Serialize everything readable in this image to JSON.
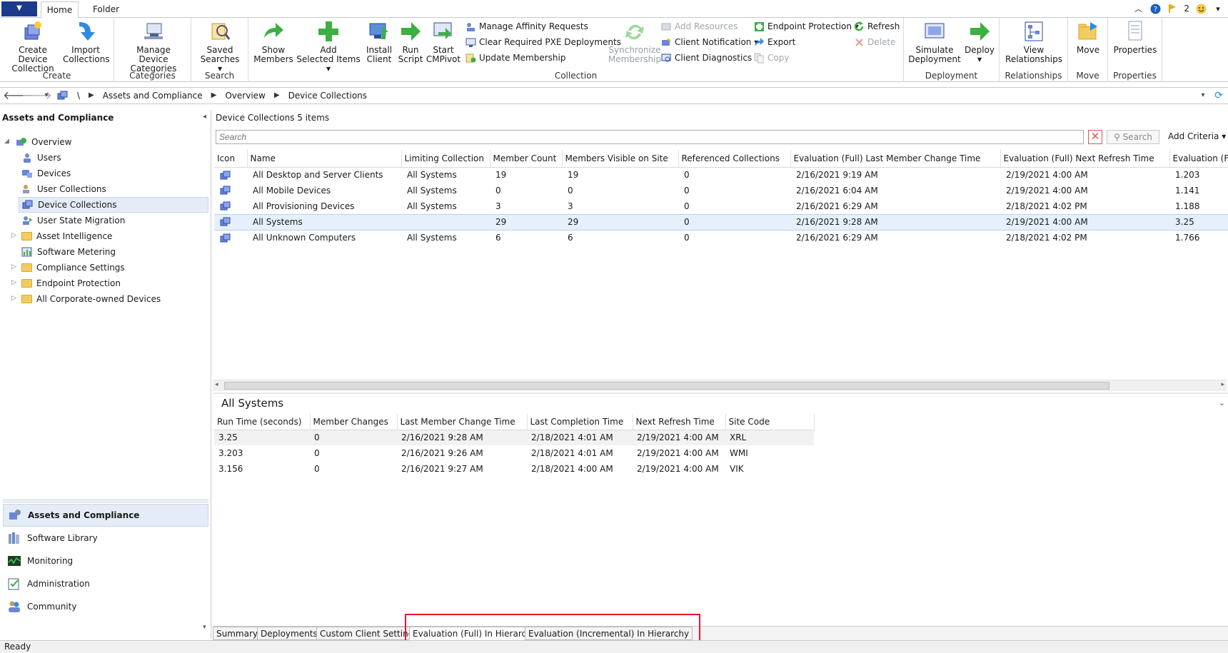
{
  "ribbon_tabs": {
    "home": "Home",
    "folder": "Folder"
  },
  "top_right": {
    "notification_count": "2"
  },
  "ribbon": {
    "create": {
      "label": "Create",
      "create_device_collection": [
        "Create Device",
        "Collection"
      ],
      "import_collections": [
        "Import",
        "Collections"
      ]
    },
    "categories": {
      "label": "Categories",
      "manage_categories": [
        "Manage Device",
        "Categories"
      ]
    },
    "search": {
      "label": "Search",
      "saved_searches": [
        "Saved",
        "Searches ▾"
      ]
    },
    "collection": {
      "label": "Collection",
      "show_members": [
        "Show",
        "Members"
      ],
      "add_selected": [
        "Add",
        "Selected Items ▾"
      ],
      "install_client": [
        "Install",
        "Client"
      ],
      "run_script": [
        "Run",
        "Script"
      ],
      "start_cmpivot": [
        "Start",
        "CMPivot"
      ],
      "manage_affinity": "Manage Affinity Requests",
      "clear_pxe": "Clear Required PXE Deployments",
      "update_membership": "Update Membership",
      "synchronize_membership": [
        "Synchronize",
        "Membership"
      ],
      "add_resources": "Add Resources",
      "client_notification": "Client Notification ▾",
      "client_diagnostics": "Client Diagnostics ▾",
      "endpoint_protection": "Endpoint Protection ▾",
      "export": "Export",
      "copy": "Copy",
      "refresh": "Refresh",
      "delete": "Delete"
    },
    "deployment": {
      "label": "Deployment",
      "simulate": [
        "Simulate",
        "Deployment"
      ],
      "deploy": [
        "Deploy",
        "▾"
      ]
    },
    "relationships": {
      "label": "Relationships",
      "view": [
        "View",
        "Relationships"
      ]
    },
    "move": {
      "label": "Move",
      "move": "Move"
    },
    "properties": {
      "label": "Properties",
      "properties": "Properties"
    }
  },
  "breadcrumb": [
    "\\",
    "Assets and Compliance",
    "Overview",
    "Device Collections"
  ],
  "sidebar": {
    "title": "Assets and Compliance",
    "tree": [
      {
        "label": "Overview"
      },
      {
        "label": "Users"
      },
      {
        "label": "Devices"
      },
      {
        "label": "User Collections"
      },
      {
        "label": "Device Collections"
      },
      {
        "label": "User State Migration"
      },
      {
        "label": "Asset Intelligence"
      },
      {
        "label": "Software Metering"
      },
      {
        "label": "Compliance Settings"
      },
      {
        "label": "Endpoint Protection"
      },
      {
        "label": "All Corporate-owned Devices"
      }
    ],
    "workspaces": [
      {
        "label": "Assets and Compliance"
      },
      {
        "label": "Software Library"
      },
      {
        "label": "Monitoring"
      },
      {
        "label": "Administration"
      },
      {
        "label": "Community"
      }
    ]
  },
  "main": {
    "title": "Device Collections 5 items",
    "search_placeholder": "Search",
    "search_button": "Search",
    "add_criteria": "Add Criteria ▾",
    "columns": [
      "Icon",
      "Name",
      "Limiting Collection",
      "Member Count",
      "Members Visible on Site",
      "Referenced Collections",
      "Evaluation (Full) Last Member Change Time",
      "Evaluation (Full) Next Refresh Time",
      "Evaluation (Fu"
    ],
    "rows": [
      [
        "All Desktop and Server Clients",
        "All Systems",
        "19",
        "19",
        "0",
        "2/16/2021 9:19 AM",
        "2/19/2021 4:00 AM",
        "1.203"
      ],
      [
        "All Mobile Devices",
        "All Systems",
        "0",
        "0",
        "0",
        "2/16/2021 6:04 AM",
        "2/19/2021 4:00 AM",
        "1.141"
      ],
      [
        "All Provisioning Devices",
        "All Systems",
        "3",
        "3",
        "0",
        "2/16/2021 6:29 AM",
        "2/18/2021 4:02 PM",
        "1.188"
      ],
      [
        "All Systems",
        "",
        "29",
        "29",
        "0",
        "2/16/2021 9:28 AM",
        "2/19/2021 4:00 AM",
        "3.25"
      ],
      [
        "All Unknown Computers",
        "All Systems",
        "6",
        "6",
        "0",
        "2/16/2021 6:29 AM",
        "2/18/2021 4:02 PM",
        "1.766"
      ]
    ],
    "selected_row": 3
  },
  "detail": {
    "title": "All Systems",
    "columns": [
      "Run Time (seconds)",
      "Member Changes",
      "Last Member Change Time",
      "Last Completion Time",
      "Next Refresh Time",
      "Site Code"
    ],
    "rows": [
      [
        "3.25",
        "0",
        "2/16/2021 9:28 AM",
        "2/18/2021 4:01 AM",
        "2/19/2021 4:00 AM",
        "XRL"
      ],
      [
        "3.203",
        "0",
        "2/16/2021 9:26 AM",
        "2/18/2021 4:01 AM",
        "2/19/2021 4:00 AM",
        "WMI"
      ],
      [
        "3.156",
        "0",
        "2/16/2021 9:27 AM",
        "2/18/2021 4:00 AM",
        "2/19/2021 4:00 AM",
        "VIK"
      ]
    ]
  },
  "bottom_tabs": [
    "Summary",
    "Deployments",
    "Custom Client Settings",
    "Evaluation (Full) In Hierarchy",
    "Evaluation (Incremental) In Hierarchy"
  ],
  "active_bottom_tab": 3,
  "status": "Ready",
  "colors": {
    "accent": "#1c3a8d",
    "highlight_box": "#e8192c",
    "selection": "#e5f0fc"
  }
}
